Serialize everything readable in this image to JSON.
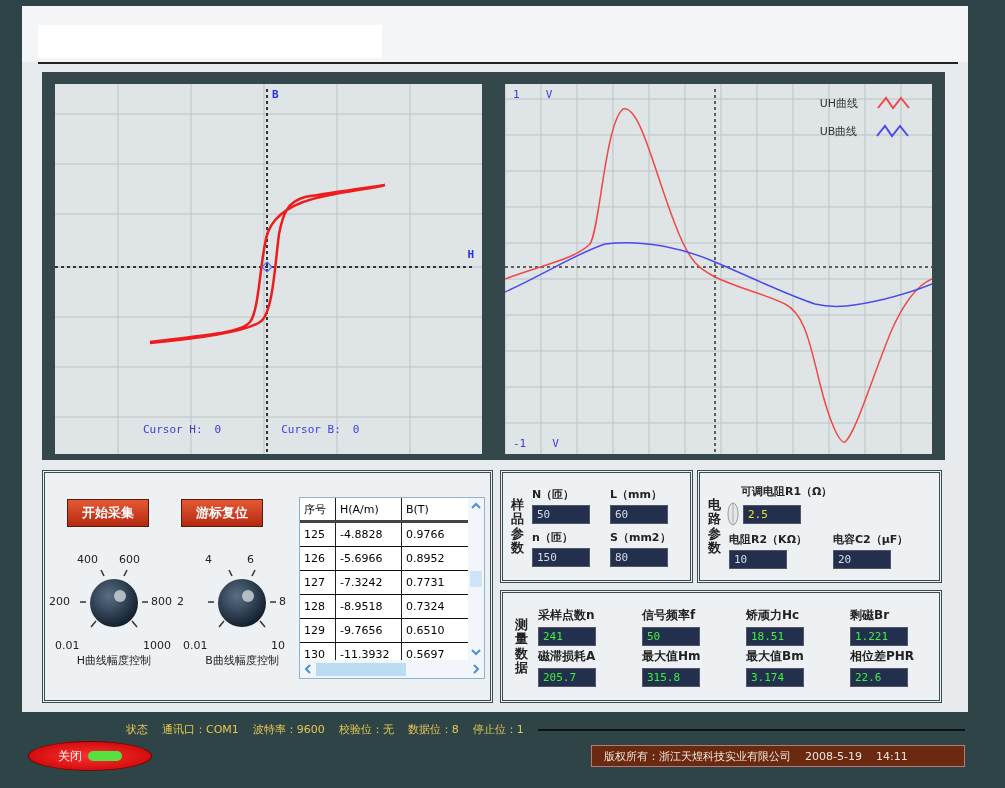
{
  "hysteresis_plot": {
    "vertical_axis": "B",
    "horizontal_axis": "H",
    "cursors": [
      {
        "label": "Cursor H:",
        "value": "0"
      },
      {
        "label": "Cursor B:",
        "value": "0"
      }
    ]
  },
  "waveform_plot": {
    "top": {
      "value": "1",
      "unit": "V"
    },
    "bottom": {
      "value": "-1",
      "unit": "V"
    },
    "legend": [
      {
        "label": "UH曲线",
        "color": "#f04848"
      },
      {
        "label": "UB曲线",
        "color": "#4a4af0"
      }
    ]
  },
  "controls": {
    "buttons": [
      "开始采集",
      "游标复位"
    ],
    "knobs": [
      {
        "label": "H曲线幅度控制",
        "scale": [
          "0.01",
          "200",
          "400",
          "600",
          "800",
          "1000"
        ]
      },
      {
        "label": "B曲线幅度控制",
        "scale": [
          "0.01",
          "2",
          "4",
          "6",
          "8",
          "10"
        ]
      }
    ]
  },
  "table": {
    "columns": [
      "序号",
      "H(A/m)",
      "B(T)"
    ],
    "rows": [
      [
        "125",
        "-4.8828",
        "0.9766"
      ],
      [
        "126",
        "-5.6966",
        "0.8952"
      ],
      [
        "127",
        "-7.3242",
        "0.7731"
      ],
      [
        "128",
        "-8.9518",
        "0.7324"
      ],
      [
        "129",
        "-9.7656",
        "0.6510"
      ],
      [
        "130",
        "-11.3932",
        "0.5697"
      ]
    ]
  },
  "sample_params": {
    "title": "样品参数",
    "fields": [
      {
        "label": "N（匝）",
        "value": "50"
      },
      {
        "label": "L（mm）",
        "value": "60"
      },
      {
        "label": "n（匝）",
        "value": "150"
      },
      {
        "label": "S（mm2）",
        "value": "80"
      }
    ]
  },
  "circuit_params": {
    "title": "电路参数",
    "fields": [
      {
        "kind": "spinner",
        "label": "可调电阻R1（Ω）",
        "value": "2.5"
      },
      {
        "kind": "text",
        "label": "电阻R2（KΩ）",
        "value": "10"
      },
      {
        "kind": "text",
        "label": "电容C2（μF）",
        "value": "20"
      }
    ]
  },
  "measurements": {
    "title": "测量数据",
    "fields": [
      {
        "label": "采样点数n",
        "value": "241"
      },
      {
        "label": "信号频率f",
        "value": "50"
      },
      {
        "label": "矫顽力Hc",
        "value": "18.51"
      },
      {
        "label": "剩磁Br",
        "value": "1.221"
      },
      {
        "label": "磁滞损耗A",
        "value": "205.7"
      },
      {
        "label": "最大值Hm",
        "value": "315.8"
      },
      {
        "label": "最大值Bm",
        "value": "3.174"
      },
      {
        "label": "相位差PHR",
        "value": "22.6"
      }
    ]
  },
  "status_bar": {
    "items": [
      "状态",
      "通讯口：COM1",
      "波特率：9600",
      "校验位：无",
      "数据位：8",
      "停止位：1"
    ],
    "close_button": {
      "label": "关闭",
      "lamp_on": true
    },
    "copyright": "版权所有：浙江天煌科技实业有限公司",
    "date": "2008-5-19",
    "time": "14:11"
  }
}
